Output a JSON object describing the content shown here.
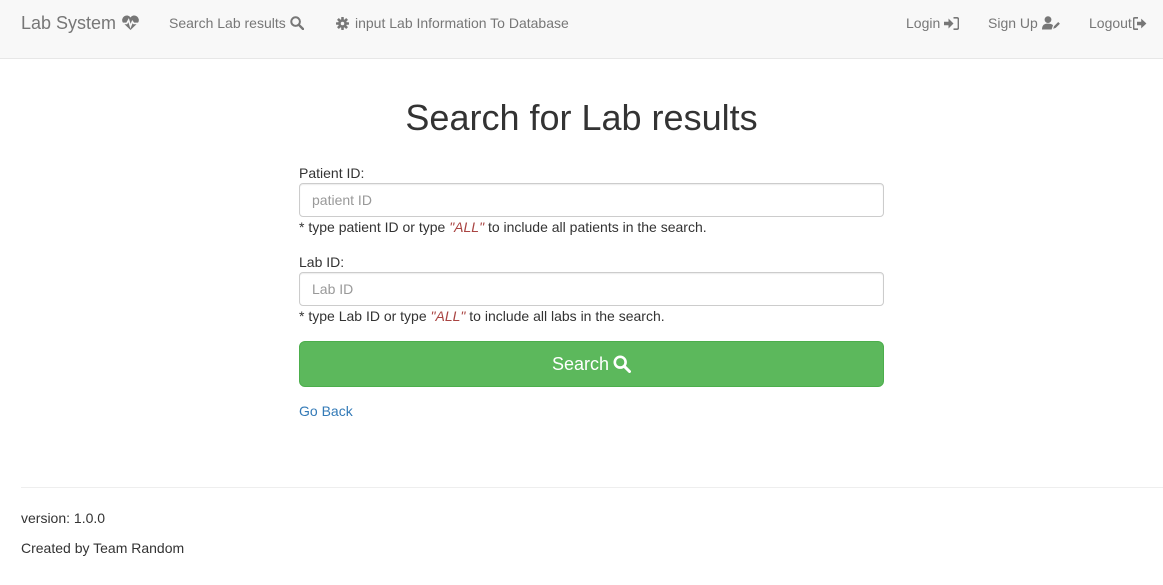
{
  "navbar": {
    "brand": "Lab System",
    "brand_icon": "heartbeat-icon",
    "search_link": "Search Lab results",
    "search_icon": "search-icon",
    "input_link": "input Lab Information To Database",
    "input_icon": "gear-icon",
    "login": "Login",
    "login_icon": "sign-in-icon",
    "signup": "Sign Up",
    "signup_icon": "user-edit-icon",
    "logout": "Logout",
    "logout_icon": "sign-out-icon"
  },
  "main": {
    "title": "Search for Lab results",
    "patient": {
      "label": "Patient ID:",
      "placeholder": "patient ID",
      "value": "",
      "hint_prefix": "* type patient ID or type ",
      "hint_keyword": "\"ALL\"",
      "hint_suffix": " to include all patients in the search."
    },
    "lab": {
      "label": "Lab ID:",
      "placeholder": "Lab ID",
      "value": "",
      "hint_prefix": "* type Lab ID or type ",
      "hint_keyword": "\"ALL\"",
      "hint_suffix": " to include all labs in the search."
    },
    "search_button": "Search",
    "go_back": "Go Back"
  },
  "footer": {
    "version": "version: 1.0.0",
    "credit": "Created by Team Random"
  },
  "colors": {
    "navbar_bg": "#f8f8f8",
    "nav_text": "#777777",
    "button_green": "#5cb85c",
    "link_blue": "#337ab7",
    "keyword_red": "#a94442"
  }
}
